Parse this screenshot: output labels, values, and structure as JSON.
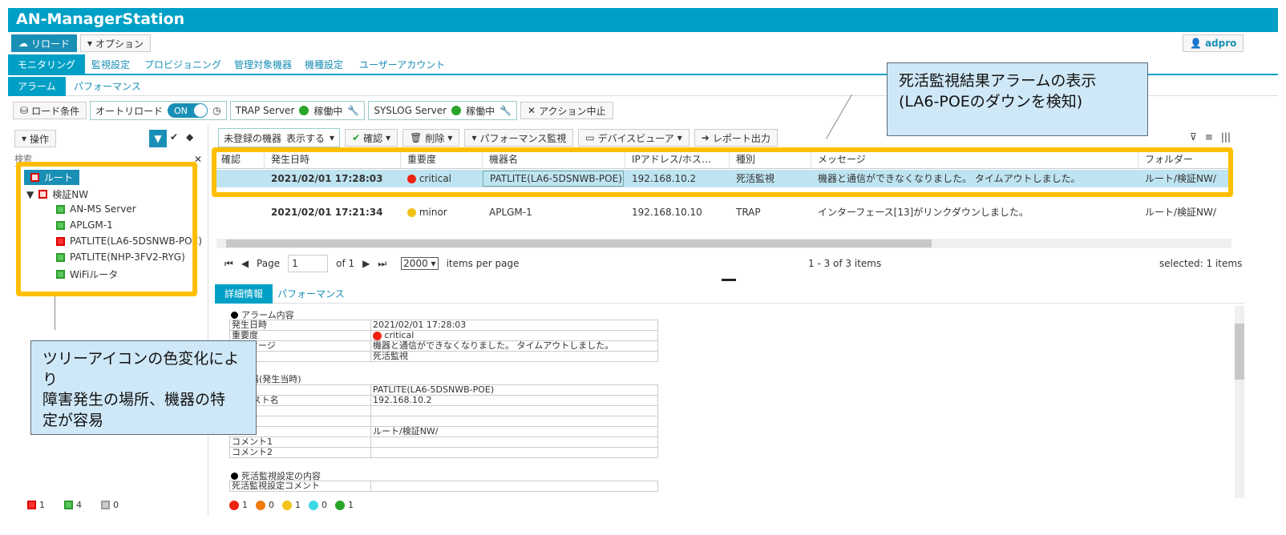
{
  "app": {
    "title": "AN-ManagerStation",
    "user": "adpro"
  },
  "toolbar": {
    "reload": "リロード",
    "options": "オプション"
  },
  "tabs": [
    "モニタリング",
    "監視設定",
    "プロビジョニング",
    "管理対象機器",
    "機種設定",
    "ユーザーアカウント"
  ],
  "subtabs": [
    "アラーム",
    "パフォーマンス"
  ],
  "controls": {
    "load_cond": "ロード条件",
    "auto_reload": "オートリロード",
    "toggle": "ON",
    "trap": "TRAP Server",
    "syslog": "SYSLOG Server",
    "running": "稼働中",
    "action_stop": "アクション中止"
  },
  "left": {
    "ops": "操作",
    "search_placeholder": "検索",
    "tree": [
      "ルート",
      "検証NW",
      "AN-MS Server",
      "APLGM-1",
      "PATLITE(LA6-5DSNWB-POE)",
      "PATLITE(NHP-3FV2-RYG)",
      "WiFiルータ"
    ],
    "status": [
      "1",
      "4",
      "0"
    ]
  },
  "gridbar": {
    "unreg": "未登録の機器",
    "show": "表示する",
    "confirm": "確認",
    "delete": "削除",
    "perf": "パフォーマンス監視",
    "device": "デバイスビューア",
    "report": "レポート出力"
  },
  "grid": {
    "cols": [
      "確認",
      "発生日時",
      "重要度",
      "機器名",
      "IPアドレス/ホス…",
      "種別",
      "メッセージ",
      "フォルダー"
    ],
    "rows": [
      {
        "time": "2021/02/01 17:28:03",
        "sev": "critical",
        "dev": "PATLITE(LA6-5DSNWB-POE)",
        "ip": "192.168.10.2",
        "kind": "死活監視",
        "msg": "機器と通信ができなくなりました。 タイムアウトしました。",
        "folder": "ルート/検証NW/"
      },
      {
        "time": "2021/02/01 17:21:34",
        "sev": "minor",
        "dev": "APLGM-1",
        "ip": "192.168.10.10",
        "kind": "TRAP",
        "msg": "インターフェース[13]がリンクダウンしました。",
        "folder": "ルート/検証NW/"
      }
    ]
  },
  "pager": {
    "page": "Page",
    "pagenum": "1",
    "of": "of 1",
    "size": "2000",
    "ipp": "items per page",
    "range": "1 - 3 of 3 items",
    "selected": "selected: 1 items"
  },
  "detail": {
    "tabs": [
      "詳細情報",
      "パフォーマンス"
    ],
    "s1": "アラーム内容",
    "s1rows": [
      [
        "発生日時",
        "2021/02/01 17:28:03"
      ],
      [
        "重要度",
        "critical"
      ],
      [
        "メッセージ",
        "機器と通信ができなくなりました。 タイムアウトしました。"
      ],
      [
        "",
        "死活監視"
      ]
    ],
    "s2": "機器(発生当時)",
    "s2rows": [
      [
        "",
        "PATLITE(LA6-5DSNWB-POE)"
      ],
      [
        "ス/ホスト名",
        "192.168.10.2"
      ],
      [
        "",
        ""
      ],
      [
        "名",
        ""
      ],
      [
        "ー",
        "ルート/検証NW/"
      ],
      [
        "コメント1",
        ""
      ],
      [
        "コメント2",
        ""
      ]
    ],
    "s3": "死活監視設定の内容",
    "s3row": "死活監視設定コメント"
  },
  "bottom_status": [
    "1",
    "0",
    "1",
    "0",
    "1"
  ],
  "callouts": {
    "top": "死活監視結果アラームの表示\n(LA6-POEのダウンを検知)",
    "left": "ツリーアイコンの色変化により\n障害発生の場所、機器の特\n定が容易"
  }
}
